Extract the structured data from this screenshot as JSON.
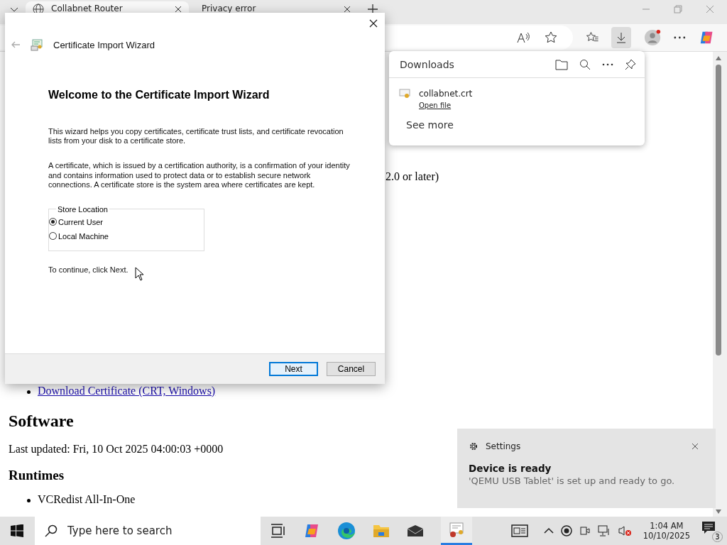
{
  "browser": {
    "tabs": [
      {
        "title": "Collabnet Router",
        "selected": true
      },
      {
        "title": "Privacy error",
        "selected": false
      }
    ],
    "page": {
      "fragment": "2.0 or later)",
      "links": [
        "Download Certificate (CRT, Windows)"
      ],
      "heading": "Software",
      "updated": "Last updated: Fri, 10 Oct 2025 04:00:03 +0000",
      "subheading": "Runtimes",
      "items": [
        "VCRedist All-In-One"
      ]
    }
  },
  "downloads": {
    "title": "Downloads",
    "files": [
      {
        "name": "collabnet.crt",
        "action": "Open file"
      }
    ],
    "see_more": "See more"
  },
  "dialog": {
    "title": "Certificate Import Wizard",
    "heading": "Welcome to the Certificate Import Wizard",
    "paragraphs": [
      "This wizard helps you copy certificates, certificate trust lists, and certificate revocation lists from your disk to a certificate store.",
      "A certificate, which is issued by a certification authority, is a confirmation of your identity and contains information used to protect data or to establish secure network connections. A certificate store is the system area where certificates are kept."
    ],
    "store_location": {
      "label": "Store Location",
      "options": [
        {
          "label": "Current User",
          "selected": true
        },
        {
          "label": "Local Machine",
          "selected": false
        }
      ]
    },
    "hint": "To continue, click Next.",
    "buttons": [
      {
        "label": "Next",
        "kind": "default"
      },
      {
        "label": "Cancel",
        "kind": "normal"
      }
    ]
  },
  "toast": {
    "app": "Settings",
    "title": "Device is ready",
    "message": "'QEMU USB Tablet' is set up and ready to go."
  },
  "taskbar": {
    "search_placeholder": "Type here to search",
    "time": "1:04 AM",
    "date": "10/10/2025",
    "notification_count": "3"
  }
}
